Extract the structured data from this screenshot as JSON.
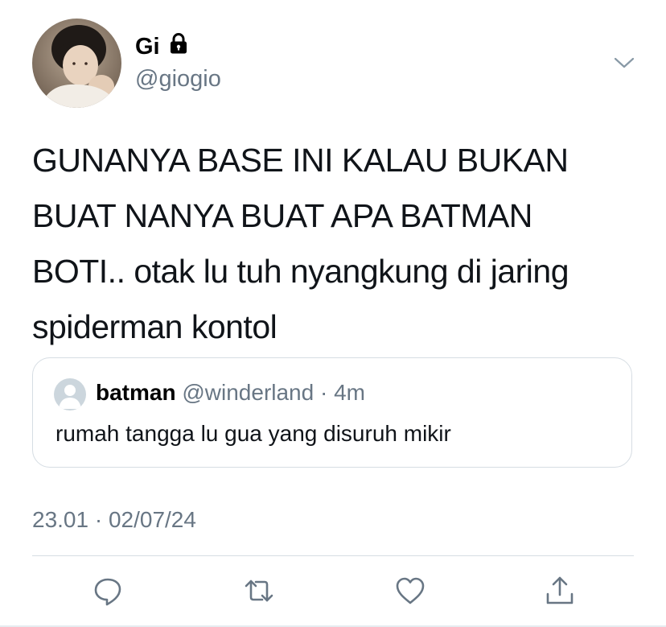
{
  "tweet": {
    "display_name": "Gi",
    "username": "@giogio",
    "text_lines": [
      "GUNANYA BASE INI KALAU BUKAN",
      "BUAT NANYA BUAT APA BATMAN",
      "BOTI.. otak lu tuh nyangkung di jaring",
      "spiderman kontol"
    ],
    "timestamp": "23.01 · 02/07/24"
  },
  "quoted": {
    "name": "batman",
    "meta": "@winderland · 4m",
    "text": "rumah tangga lu gua yang disuruh mikir"
  },
  "icons": {
    "lock": "lock-icon",
    "more": "chevron-down-icon",
    "reply": "reply-icon",
    "retweet": "retweet-icon",
    "like": "heart-icon",
    "share": "share-icon"
  },
  "colors": {
    "text": "#101419",
    "secondary": "#687684",
    "border": "#d6dde3"
  }
}
